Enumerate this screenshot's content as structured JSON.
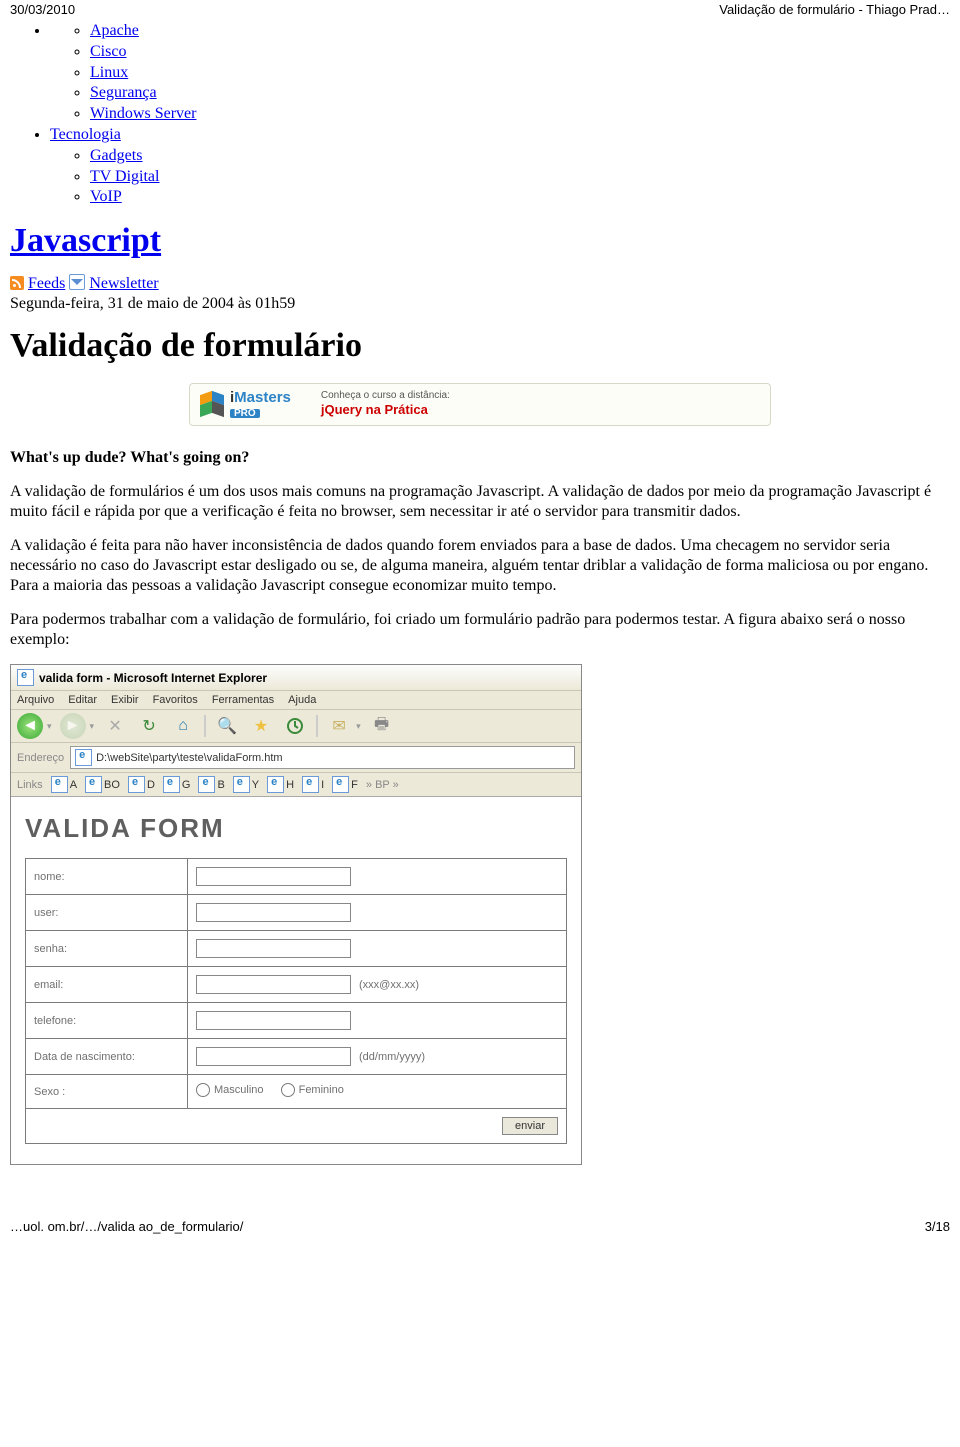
{
  "header": {
    "date": "30/03/2010",
    "page_title": "Validação de formulário - Thiago Prad…"
  },
  "nav": {
    "sublist1": [
      "Apache",
      "Cisco",
      "Linux",
      "Segurança",
      "Windows Server"
    ],
    "item2": "Tecnologia",
    "sublist2": [
      "Gadgets",
      "TV Digital",
      "VoIP"
    ]
  },
  "category_heading": "Javascript",
  "feeds": {
    "feeds_label": "Feeds",
    "newsletter_label": "Newsletter"
  },
  "datetime_line": "Segunda-feira, 31 de maio de 2004 às 01h59",
  "article_title": "Validação de formulário",
  "promo": {
    "logo_i": "i",
    "logo_masters": "Masters",
    "logo_pro": "PRO",
    "label": "Conheça o curso a distância:",
    "link": "jQuery na Prática"
  },
  "paragraphs": {
    "p1_bold": "What's up dude? What's going on?",
    "p2": "A validação de formulários é um dos usos mais comuns na programação Javascript. A validação de dados por meio da programação Javascript é muito fácil e rápida por que a verificação é feita no browser, sem necessitar ir até o servidor para transmitir dados.",
    "p3": "A validação é feita para não haver inconsistência de dados quando forem enviados para a base de dados. Uma checagem no servidor seria necessário no caso do Javascript estar desligado ou se, de alguma maneira, alguém tentar driblar a validação de forma maliciosa ou por engano. Para a maioria das pessoas a validação Javascript consegue economizar muito tempo.",
    "p4": "Para podermos trabalhar com a validação de formulário, foi criado um formulário padrão para podermos testar. A figura abaixo será o nosso exemplo:"
  },
  "browser": {
    "window_title": "valida form - Microsoft Internet Explorer",
    "menu": [
      "Arquivo",
      "Editar",
      "Exibir",
      "Favoritos",
      "Ferramentas",
      "Ajuda"
    ],
    "toolbar_icons": {
      "back": "◄",
      "fwd": "►",
      "sep": "▾",
      "stop": "✕",
      "refresh": "↻",
      "home": "⌂",
      "search": "🔍",
      "star": "★",
      "history": "",
      "mail": "✉",
      "print": "🖶"
    },
    "address_label": "Endereço",
    "address_value": "D:\\webSite\\party\\teste\\validaForm.htm",
    "links_label": "Links",
    "links": [
      "A",
      "BO",
      "D",
      "G",
      "B",
      "Y",
      "H",
      "I",
      "F"
    ],
    "links_tail": "» BP »"
  },
  "form": {
    "title": "VALIDA FORM",
    "rows": [
      {
        "label": "nome:"
      },
      {
        "label": "user:"
      },
      {
        "label": "senha:"
      },
      {
        "label": "email:",
        "hint": "(xxx@xx.xx)"
      },
      {
        "label": "telefone:"
      },
      {
        "label": "Data de nascimento:",
        "hint": "(dd/mm/yyyy)"
      }
    ],
    "sexo_label": "Sexo :",
    "sexo_options": [
      "Masculino",
      "Feminino"
    ],
    "submit": "enviar"
  },
  "footer": {
    "left": "…uol. om.br/…/valida ao_de_formulario/",
    "right": "3/18"
  }
}
